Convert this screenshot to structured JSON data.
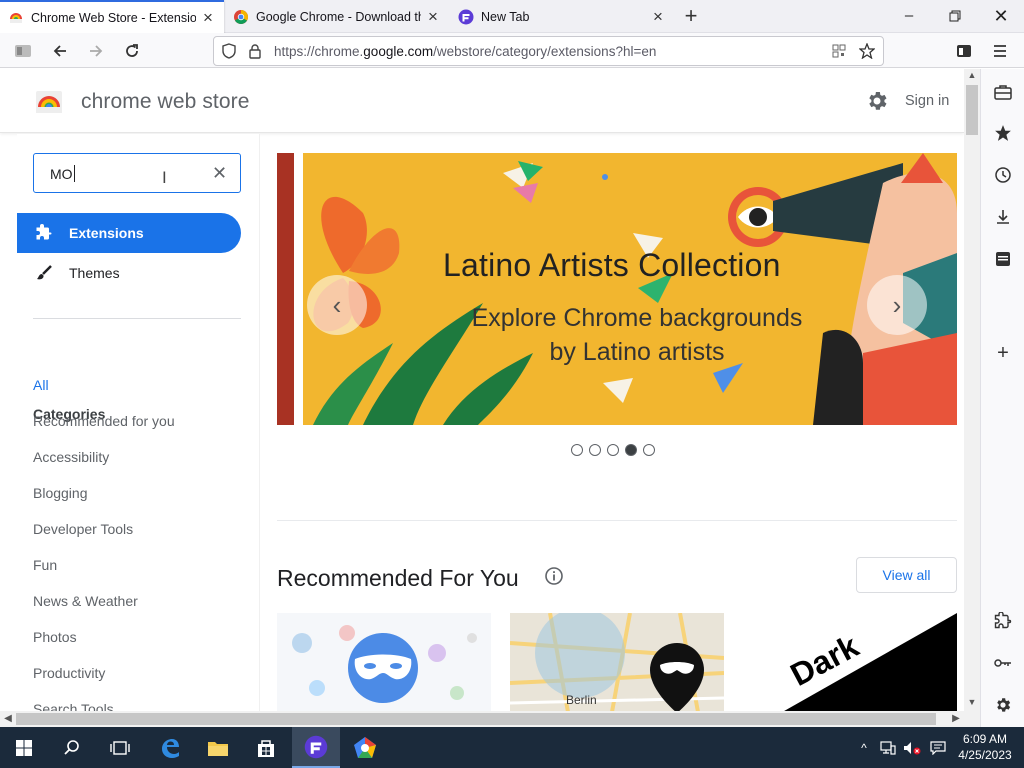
{
  "browser": {
    "tabs": [
      {
        "title": "Chrome Web Store - Extensions",
        "active": true
      },
      {
        "title": "Google Chrome - Download the",
        "active": false
      },
      {
        "title": "New Tab",
        "active": false
      }
    ],
    "url_prefix": "https://chrome.",
    "url_domain": "google.com",
    "url_path": "/webstore/category/extensions?hl=en"
  },
  "store": {
    "title": "chrome web store",
    "sign_in": "Sign in"
  },
  "sidebar": {
    "search_value": "MO",
    "nav": [
      {
        "label": "Extensions",
        "selected": true,
        "icon": "puzzle-icon"
      },
      {
        "label": "Themes",
        "selected": false,
        "icon": "brush-icon"
      }
    ],
    "categories_heading": "Categories",
    "categories": [
      "All",
      "Recommended for you",
      "Accessibility",
      "Blogging",
      "Developer Tools",
      "Fun",
      "News & Weather",
      "Photos",
      "Productivity",
      "Search Tools"
    ],
    "active_category": "All"
  },
  "carousel": {
    "title": "Latino Artists Collection",
    "subtitle_line1": "Explore Chrome backgrounds",
    "subtitle_line2": "by Latino artists",
    "dot_count": 5,
    "active_dot": 4
  },
  "recommended": {
    "title": "Recommended For You",
    "view_all": "View all",
    "card3_text": "Dark",
    "card2_map_label": "Berlin"
  },
  "taskbar": {
    "time": "6:09 AM",
    "date": "4/25/2023"
  },
  "colors": {
    "accent": "#1a73e8",
    "banner": "#f2b62f",
    "taskbar": "#1b2a3b"
  }
}
